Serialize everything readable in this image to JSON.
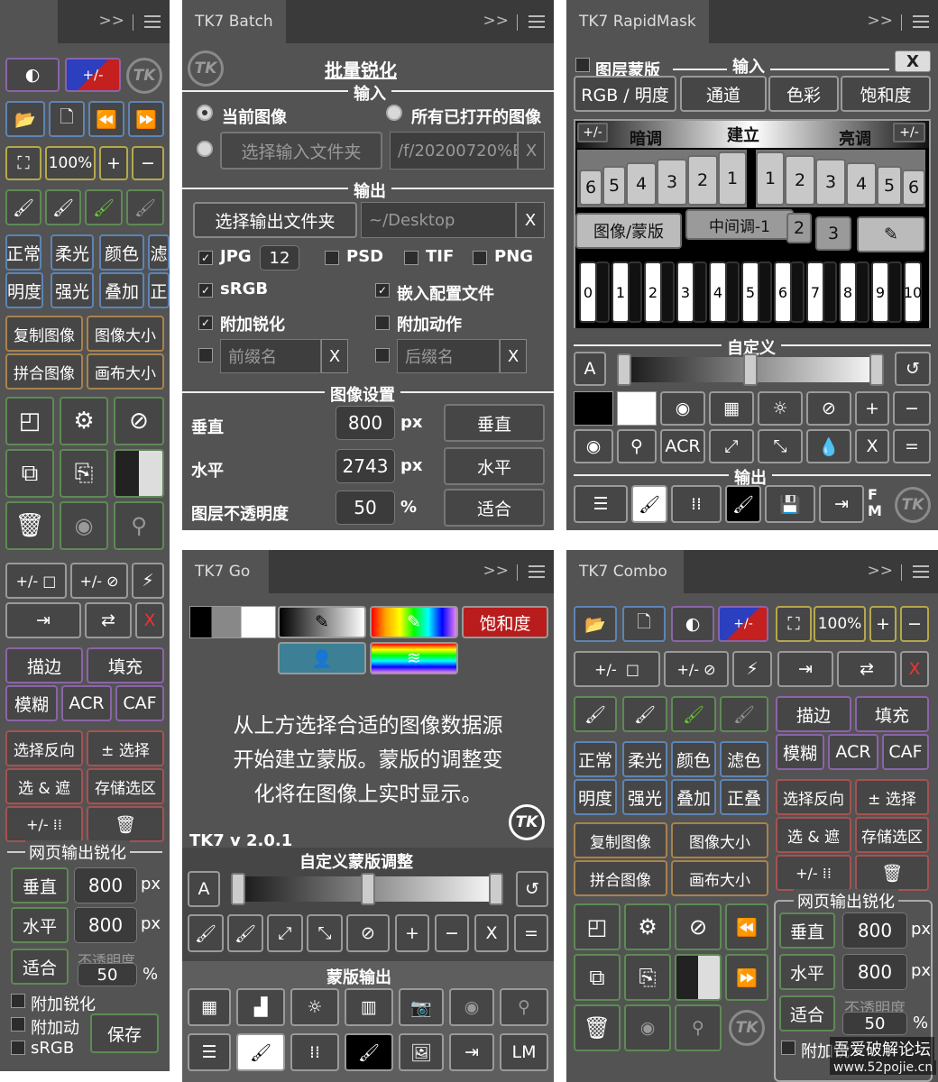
{
  "left_panel": {
    "row_tools": [
      "正常",
      "柔光",
      "颜色",
      "滤"
    ],
    "row_tools2": [
      "明度",
      "强光",
      "叠加",
      "正"
    ],
    "buttons_img": [
      "复制图像",
      "图像大小",
      "拼合图像",
      "画布大小"
    ],
    "zoom": "100%",
    "pm_label": "+/-",
    "fx_row": [
      "描边",
      "填充"
    ],
    "fx_row2": [
      "模糊",
      "ACR",
      "CAF"
    ],
    "sel_row": [
      "选择反向",
      "± 选择"
    ],
    "sel_row2": [
      "选 & 遮",
      "存储选区"
    ],
    "web_title": "网页输出锐化",
    "vert": "垂直",
    "vert_val": "800",
    "px": "px",
    "horz": "水平",
    "horz_val": "800",
    "fit": "适合",
    "opacity_label": "不透明度",
    "opacity_val": "50",
    "pct": "%",
    "chk1": "附加锐化",
    "chk2": "附加动",
    "chk3": "sRGB",
    "save": "保存"
  },
  "batch": {
    "tab": "TK7 Batch",
    "title": "批量锐化",
    "input": "输入",
    "radio1": "当前图像",
    "radio2": "所有已打开的图像",
    "choose_in": "选择输入文件夹",
    "in_path": "/f/20200720%E",
    "output": "输出",
    "choose_out": "选择输出文件夹",
    "out_path": "~/Desktop",
    "jpg": "JPG",
    "jpg_q": "12",
    "psd": "PSD",
    "tif": "TIF",
    "png": "PNG",
    "srgb": "sRGB",
    "embed": "嵌入配置文件",
    "add_sharp": "附加锐化",
    "add_action": "附加动作",
    "prefix": "前缀名",
    "suffix": "后缀名",
    "img_settings": "图像设置",
    "v_label": "垂直",
    "v_val": "800",
    "h_label": "水平",
    "h_val": "2743",
    "op_label": "图层不透明度",
    "op_val": "50",
    "px": "px",
    "pct": "%",
    "btn_v": "垂直",
    "btn_h": "水平",
    "btn_fit": "适合",
    "x": "X"
  },
  "rapid": {
    "tab": "TK7 RapidMask",
    "layer_mask": "图层蒙版",
    "input": "输入",
    "rgb": "RGB / 明度",
    "channel": "通道",
    "color": "色彩",
    "sat": "饱和度",
    "dark": "暗调",
    "build": "建立",
    "light": "亮调",
    "nums_left": [
      "6",
      "5",
      "4",
      "3",
      "2",
      "1"
    ],
    "nums_right": [
      "1",
      "2",
      "3",
      "4",
      "5",
      "6"
    ],
    "img_mask": "图像/蒙版",
    "mid": "中间调-1",
    "mid2": "2",
    "mid3": "3",
    "keys": [
      "0",
      "1",
      "2",
      "3",
      "4",
      "5",
      "6",
      "7",
      "8",
      "9",
      "10"
    ],
    "custom": "自定义",
    "a": "A",
    "acr": "ACR",
    "x": "X",
    "eq": "=",
    "plus": "+",
    "minus": "−",
    "output": "输出",
    "fm": "F M",
    "pm": "+/-"
  },
  "go": {
    "tab": "TK7 Go",
    "sat": "饱和度",
    "message": "从上方选择合适的图像数据源开始建立蒙版。蒙版的调整变化将在图像上实时显示。",
    "message_lines": [
      "从上方选择合适的图像数据源",
      "开始建立蒙版。蒙版的调整变",
      "化将在图像上实时显示。"
    ],
    "version": "TK7 v 2.0.1",
    "custom": "自定义蒙版调整",
    "a": "A",
    "plus": "+",
    "minus": "−",
    "x": "X",
    "eq": "=",
    "mask_out": "蒙版输出",
    "lm": "LM"
  },
  "combo": {
    "tab": "TK7 Combo",
    "zoom": "100%",
    "pm": "+/-",
    "fx": [
      "描边",
      "填充"
    ],
    "fx2": [
      "模糊",
      "ACR",
      "CAF"
    ],
    "tools": [
      "正常",
      "柔光",
      "颜色",
      "滤色"
    ],
    "tools2": [
      "明度",
      "强光",
      "叠加",
      "正叠"
    ],
    "sel": [
      "选择反向",
      "± 选择"
    ],
    "sel2": [
      "选 & 遮",
      "存储选区"
    ],
    "img": [
      "复制图像",
      "图像大小",
      "拼合图像",
      "画布大小"
    ],
    "web_title": "网页输出锐化",
    "vert": "垂直",
    "vert_val": "800",
    "horz": "水平",
    "horz_val": "800",
    "px": "px",
    "fit": "适合",
    "opacity_label": "不透明度",
    "opacity_val": "50",
    "pct": "%",
    "chk1": "附加锐",
    "watermark": "吾爱破解论坛",
    "watermark_url": "www.52pojie.cn"
  },
  "colors": {
    "panel": "#535353",
    "tabbar": "#3a3a3a",
    "green": "#5e8a55",
    "purple": "#8a64a8",
    "brown": "#a8824f",
    "blue": "#5d84b5",
    "red": "#a55252",
    "teal": "#3d7f94"
  }
}
